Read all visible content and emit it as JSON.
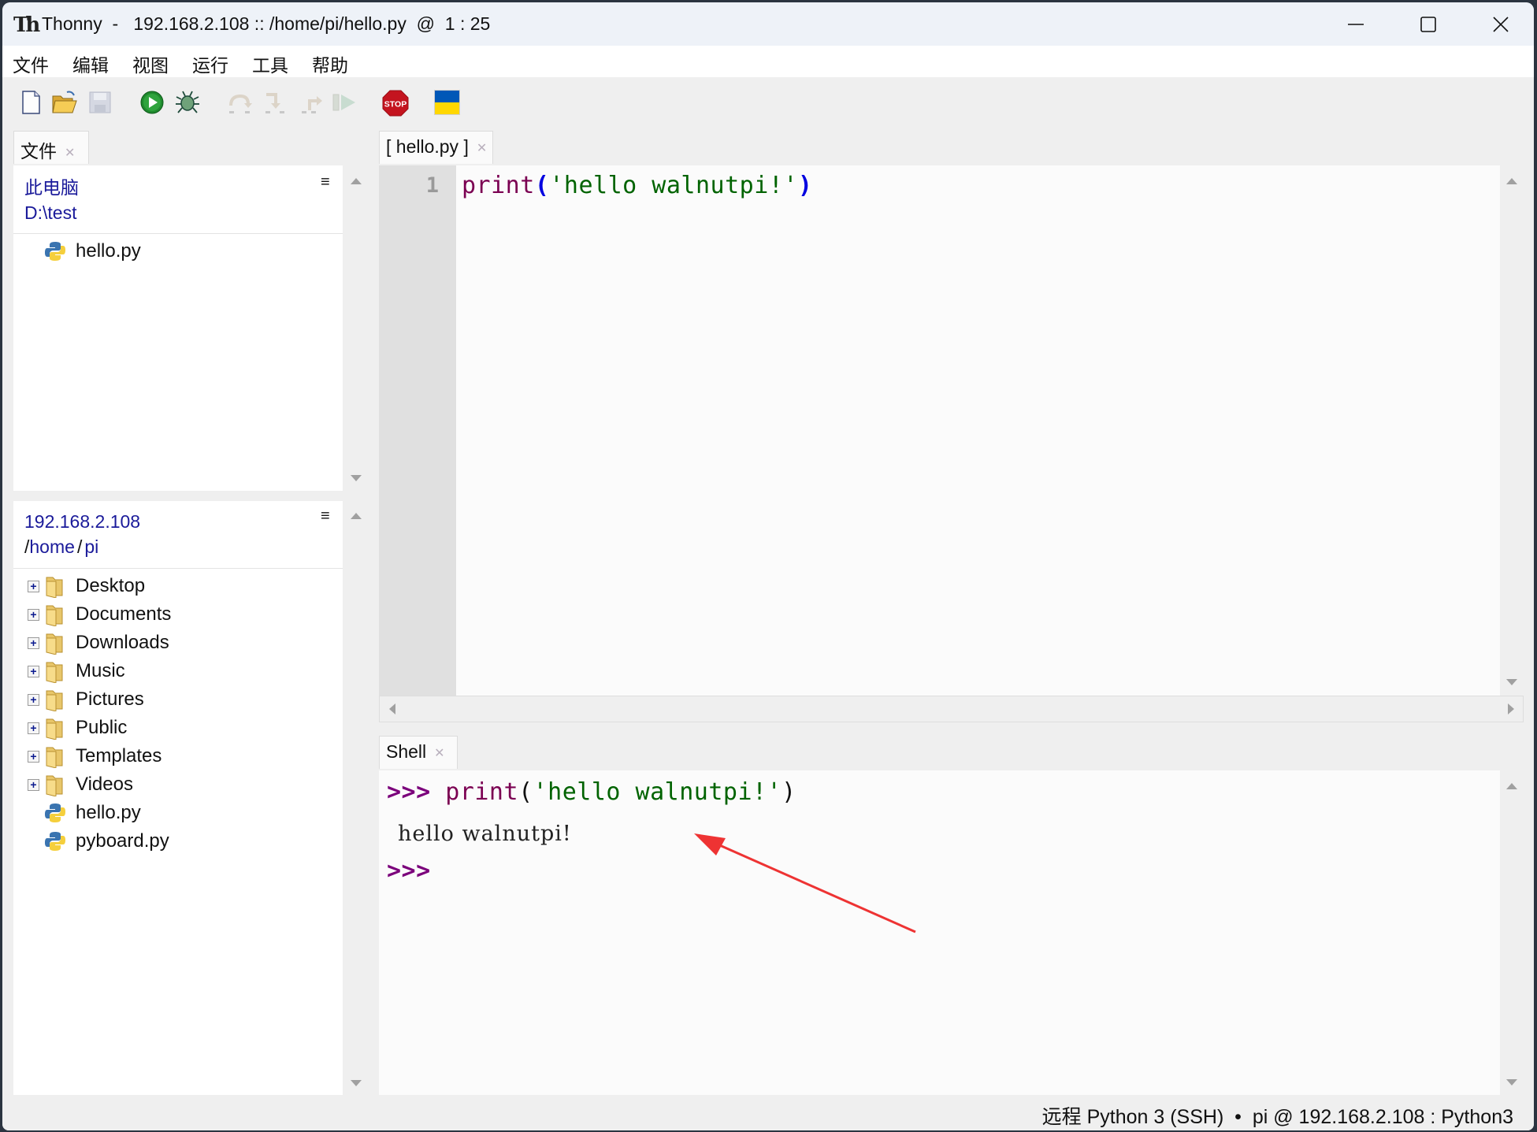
{
  "window": {
    "title": "Thonny  -   192.168.2.108 :: /home/pi/hello.py  @  1 : 25",
    "logo": "Th",
    "controls": [
      "minimize",
      "maximize",
      "close"
    ]
  },
  "menu": {
    "items": [
      {
        "label": "文件"
      },
      {
        "label": "编辑"
      },
      {
        "label": "视图"
      },
      {
        "label": "运行"
      },
      {
        "label": "工具"
      },
      {
        "label": "帮助"
      }
    ]
  },
  "toolbar": {
    "buttons": [
      {
        "icon": "new-file-icon",
        "enabled": true
      },
      {
        "icon": "open-folder-icon",
        "enabled": true
      },
      {
        "icon": "save-icon",
        "enabled": false
      },
      {
        "icon": "run-icon",
        "enabled": true
      },
      {
        "icon": "debug-bug-icon",
        "enabled": true
      },
      {
        "icon": "step-over-icon",
        "enabled": false
      },
      {
        "icon": "step-into-icon",
        "enabled": false
      },
      {
        "icon": "step-out-icon",
        "enabled": false
      },
      {
        "icon": "resume-icon",
        "enabled": false
      },
      {
        "icon": "stop-icon",
        "enabled": true,
        "label": "STOP"
      },
      {
        "icon": "ukraine-flag-icon",
        "enabled": true
      }
    ],
    "colors": {
      "run": "#1f8a2e",
      "stop": "#c4141f",
      "flag_top": "#0057b7",
      "flag_bottom": "#ffd700"
    }
  },
  "files_panel": {
    "tab_label": "文件",
    "local": {
      "title": "此电脑",
      "path": "D:\\test",
      "items": [
        {
          "type": "python",
          "name": "hello.py"
        }
      ]
    },
    "remote": {
      "host": "192.168.2.108",
      "path_parts": [
        "/",
        "home",
        "/",
        "pi"
      ],
      "items": [
        {
          "type": "folder",
          "name": "Desktop"
        },
        {
          "type": "folder",
          "name": "Documents"
        },
        {
          "type": "folder",
          "name": "Downloads"
        },
        {
          "type": "folder",
          "name": "Music"
        },
        {
          "type": "folder",
          "name": "Pictures"
        },
        {
          "type": "folder",
          "name": "Public"
        },
        {
          "type": "folder",
          "name": "Templates"
        },
        {
          "type": "folder",
          "name": "Videos"
        },
        {
          "type": "python",
          "name": "hello.py"
        },
        {
          "type": "python",
          "name": "pyboard.py"
        }
      ]
    }
  },
  "editor": {
    "tab_label": "[ hello.py ]",
    "lines": [
      {
        "number": "1",
        "tokens": {
          "func": "print",
          "open": "(",
          "string": "'hello walnutpi!'",
          "close": ")"
        }
      }
    ]
  },
  "shell": {
    "tab_label": "Shell",
    "prompt": ">>>",
    "command": {
      "func": "print",
      "open": "(",
      "string": "'hello walnutpi!'",
      "close": ")"
    },
    "output": "hello walnutpi!",
    "annotation": "red-arrow pointing at output"
  },
  "statusbar": {
    "text": "远程 Python 3 (SSH)  •  pi @ 192.168.2.108 : Python3"
  }
}
